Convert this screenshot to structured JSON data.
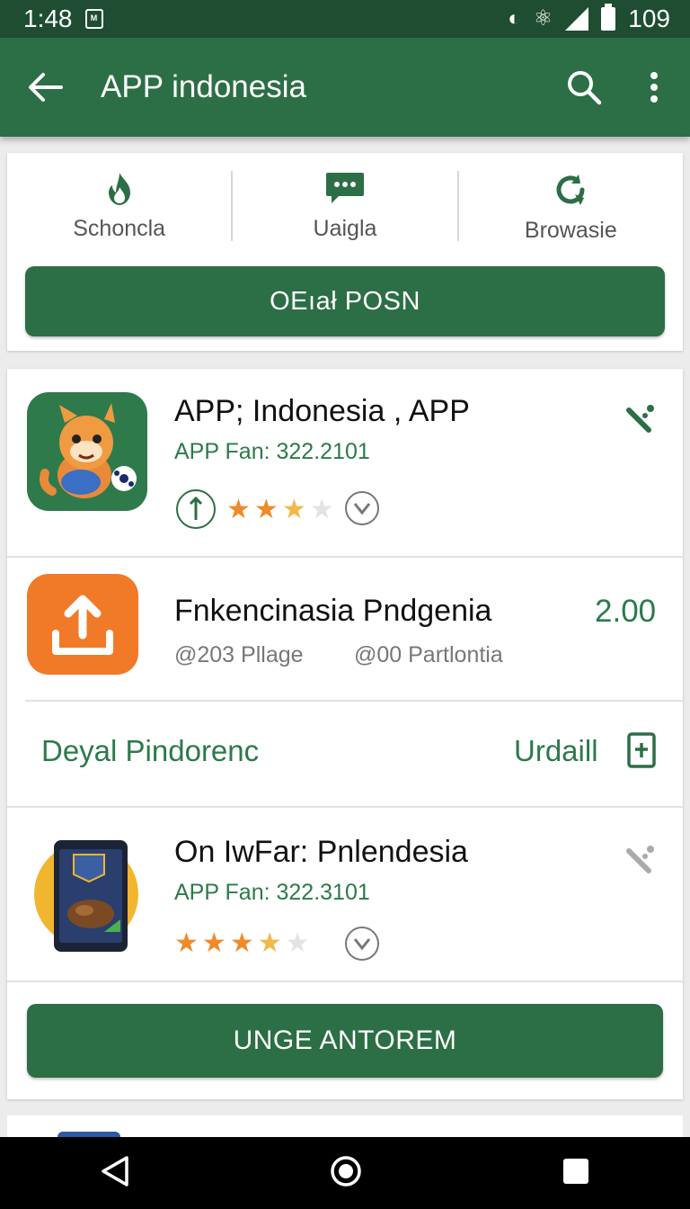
{
  "status_bar": {
    "time": "1:48",
    "battery": "109"
  },
  "app_bar": {
    "title": "APP indonesia"
  },
  "categories": [
    {
      "label": "Schoncla",
      "icon": "flame-icon"
    },
    {
      "label": "Uaigla",
      "icon": "chat-icon"
    },
    {
      "label": "Browasie",
      "icon": "refresh-icon"
    }
  ],
  "top_button": "OEıał POSN",
  "apps": [
    {
      "name": "APP; Indonesia , APP",
      "subtitle": "APP Fan: 322.2101",
      "rating": 3.5,
      "icon": "fox-mascot-icon"
    },
    {
      "name": "Fnkencinasia Pndgenia",
      "price": "2.00",
      "meta1": "@203 Pllage",
      "meta2": "@00 Partlontia",
      "icon": "upload-icon"
    },
    {
      "name": "On IwFar: Pnlendesia",
      "subtitle": "APP Fan: 322.3101",
      "rating": 3.5,
      "icon": "food-phone-icon"
    }
  ],
  "section_link": {
    "left": "Deyal Pindorenc",
    "right": "Urdaill"
  },
  "bottom_button": "UNGE ANTOREM",
  "colors": {
    "primary": "#2c6e45",
    "accent_text": "#2c7a49",
    "status_bar": "#1f4d32",
    "star": "#f08a2a",
    "orange_tile": "#f07a28"
  }
}
